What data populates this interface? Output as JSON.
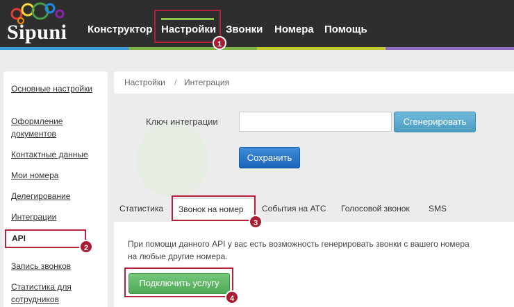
{
  "header": {
    "logo_text": "Sipuni",
    "nav": [
      "Конструктор",
      "Настройки",
      "Звонки",
      "Номера",
      "Помощь"
    ],
    "stripe_colors": [
      "#3a9ad9",
      "#7cb342",
      "#c0ca33",
      "#8e6cc2"
    ]
  },
  "sidebar": {
    "items": [
      "Основные настройки",
      "Оформление документов",
      "Контактные данные",
      "Мои номера",
      "Делегирование",
      "Интеграции",
      "API",
      "Запись звонков",
      "Статистика для сотрудников"
    ],
    "active_index": 6
  },
  "breadcrumb": {
    "root": "Настройки",
    "separator": "/",
    "current": "Интеграция"
  },
  "integration": {
    "key_label": "Ключ интеграции",
    "key_value": "",
    "generate_label": "Сгенерировать",
    "save_label": "Сохранить"
  },
  "tabs": {
    "items": [
      "Статистика",
      "Звонок на номер",
      "События на АТС",
      "Голосовой звонок",
      "SMS"
    ],
    "active_index": 1
  },
  "panel": {
    "description": "При помощи данного API у вас есть возможность генерировать звонки с вашего номера на любые другие номера.",
    "connect_label": "Подключить услугу"
  },
  "annotations": {
    "markers": [
      "1",
      "2",
      "3",
      "4"
    ],
    "color": "#b3213a"
  }
}
